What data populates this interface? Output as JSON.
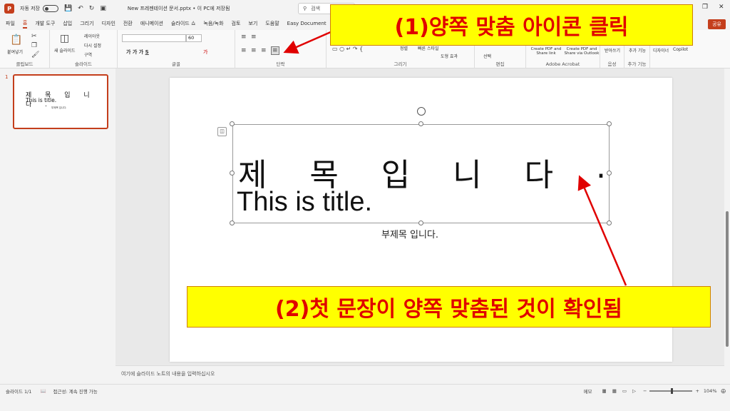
{
  "titlebar": {
    "autosave_label": "자동 저장",
    "doc_title": "New 프레젠테이션 문서.pptx • 이 PC에 저장됨",
    "search_placeholder": "검색"
  },
  "menu": {
    "tabs": [
      "파일",
      "홈",
      "개발 도구",
      "삽입",
      "그리기",
      "디자인",
      "전환",
      "애니메이션",
      "슬라이드 쇼",
      "녹음/녹화",
      "검토",
      "보기",
      "도움말",
      "Easy Document"
    ],
    "active_tab": "홈",
    "share_label": "공유"
  },
  "ribbon": {
    "paste_label": "붙여넣기",
    "clipboard_group": "클립보드",
    "new_slide_label": "새 슬라이드",
    "layout_label": "레이아웃",
    "reset_label": "다시 설정",
    "section_label": "구역",
    "slides_group": "슬라이드",
    "font_size": "60",
    "font_group": "글꼴",
    "paragraph_group": "단락",
    "draw_group": "그리기",
    "arrange_label": "정렬",
    "quick_styles_label": "빠른 스타일",
    "shape_effects_label": "도형 효과",
    "select_label": "선택",
    "edit_group": "편집",
    "create_pdf_label": "Create PDF and Share link",
    "create_pdf_outlook_label": "Create PDF and Share via Outlook",
    "acrobat_group": "Adobe Acrobat",
    "dictate_label": "받아쓰기",
    "voice_group": "음성",
    "addins_label": "추가 기능",
    "addins_group": "추가 기능",
    "designer_label": "디자이너",
    "copilot_label": "Copilot"
  },
  "thumbnail": {
    "number": "1",
    "title_line1": "제 목 입 니 다 .",
    "title_line2": "This is title.",
    "subtitle": "부제목 입니다."
  },
  "slide": {
    "title_chars": [
      "제",
      "목",
      "입",
      "니",
      "다",
      "."
    ],
    "title_line2": "This is title.",
    "subtitle": "부제목 입니다."
  },
  "callouts": {
    "step1": "(1)양쪽 맞춤 아이콘 클릭",
    "step2": "(2)첫 문장이 양쪽 맞춤된 것이 확인됨"
  },
  "notes_placeholder": "여기에 슬라이드 노트의 내용을 입력하십시오",
  "status": {
    "slide_count": "슬라이드 1/1",
    "accessibility": "접근성: 계속 진행 가능",
    "notes_label": "메모",
    "zoom": "104%"
  },
  "colors": {
    "accent": "#c43e1c",
    "callout_bg": "#ffff00",
    "callout_text": "#e00000",
    "arrow": "#e00000"
  }
}
